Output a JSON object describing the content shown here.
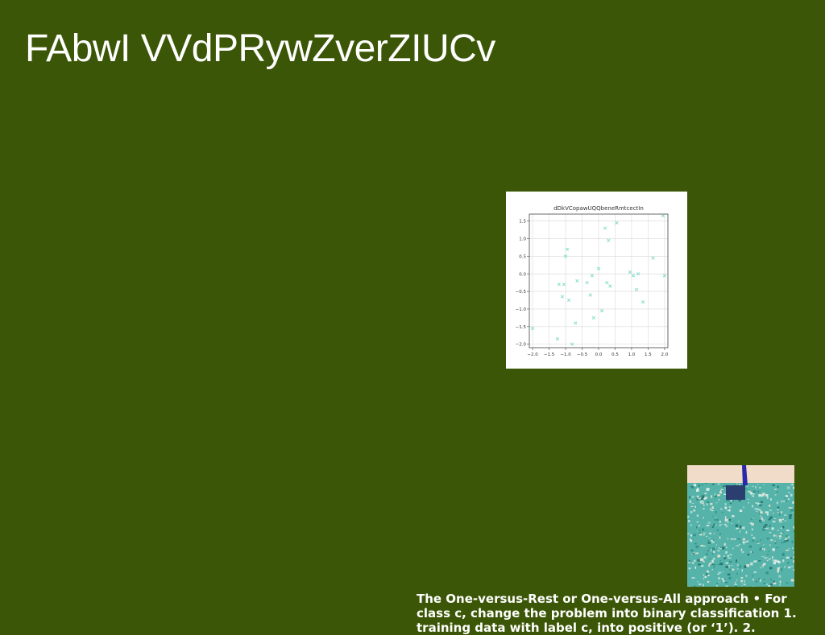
{
  "slide": {
    "title": "FAbwI VVdPRywZverZIUCv",
    "body": "The One-versus-Rest or One-versus-All approach • For class c, change the problem into binary classification 1. training data with label c, into positive (or ‘1’). 2.",
    "background_color": "#3b5606"
  },
  "chart_data": {
    "type": "scatter",
    "title": "dDkVCopawUQQbeneRmtcectIn",
    "xlabel": "",
    "ylabel": "",
    "marker": "x",
    "marker_color": "#7fdcc9",
    "grid": true,
    "legend": "none",
    "xlim": [
      -2.1,
      2.1
    ],
    "ylim": [
      -2.1,
      1.7
    ],
    "xticks": [
      -2.0,
      -1.5,
      -1.0,
      -0.5,
      0.0,
      0.5,
      1.0,
      1.5,
      2.0
    ],
    "yticks": [
      1.5,
      1.0,
      0.5,
      0.0,
      -0.5,
      -1.0,
      -1.5,
      -2.0
    ],
    "xtick_labels": [
      "−2.0",
      "−1.5",
      "−1.0",
      "−0.5",
      "0.0",
      "0.5",
      "1.0",
      "1.5",
      "2.0"
    ],
    "ytick_labels": [
      "1.5",
      "1.0",
      "0.5",
      "0.0",
      "−0.5",
      "−1.0",
      "−1.5",
      "−2.0"
    ],
    "points": [
      {
        "x": -2.0,
        "y": -1.55
      },
      {
        "x": -1.25,
        "y": -1.85
      },
      {
        "x": -1.2,
        "y": -0.3
      },
      {
        "x": -1.05,
        "y": -0.3
      },
      {
        "x": -1.1,
        "y": -0.65
      },
      {
        "x": -1.0,
        "y": 0.5
      },
      {
        "x": -0.95,
        "y": 0.7
      },
      {
        "x": -0.9,
        "y": -0.75
      },
      {
        "x": -0.8,
        "y": -2.0
      },
      {
        "x": -0.7,
        "y": -1.4
      },
      {
        "x": -0.65,
        "y": -0.2
      },
      {
        "x": -0.35,
        "y": -0.25
      },
      {
        "x": -0.25,
        "y": -0.6
      },
      {
        "x": -0.2,
        "y": -0.05
      },
      {
        "x": -0.15,
        "y": -1.25
      },
      {
        "x": 0.0,
        "y": 0.15
      },
      {
        "x": 0.1,
        "y": -1.05
      },
      {
        "x": 0.2,
        "y": 1.3
      },
      {
        "x": 0.25,
        "y": -0.25
      },
      {
        "x": 0.3,
        "y": 0.95
      },
      {
        "x": 0.35,
        "y": -0.35
      },
      {
        "x": 0.55,
        "y": 1.45
      },
      {
        "x": 0.95,
        "y": 0.05
      },
      {
        "x": 1.05,
        "y": -0.05
      },
      {
        "x": 1.15,
        "y": -0.45
      },
      {
        "x": 1.2,
        "y": 0.0
      },
      {
        "x": 1.35,
        "y": -0.8
      },
      {
        "x": 1.65,
        "y": 0.45
      },
      {
        "x": 1.95,
        "y": 1.65
      },
      {
        "x": 2.0,
        "y": -0.05
      }
    ]
  },
  "photo": {
    "sky_color": "#f0dcc8",
    "foliage_color": "#56b3a9",
    "object_color": "#2a3f6f",
    "flag_color": "#2a2aa8"
  }
}
